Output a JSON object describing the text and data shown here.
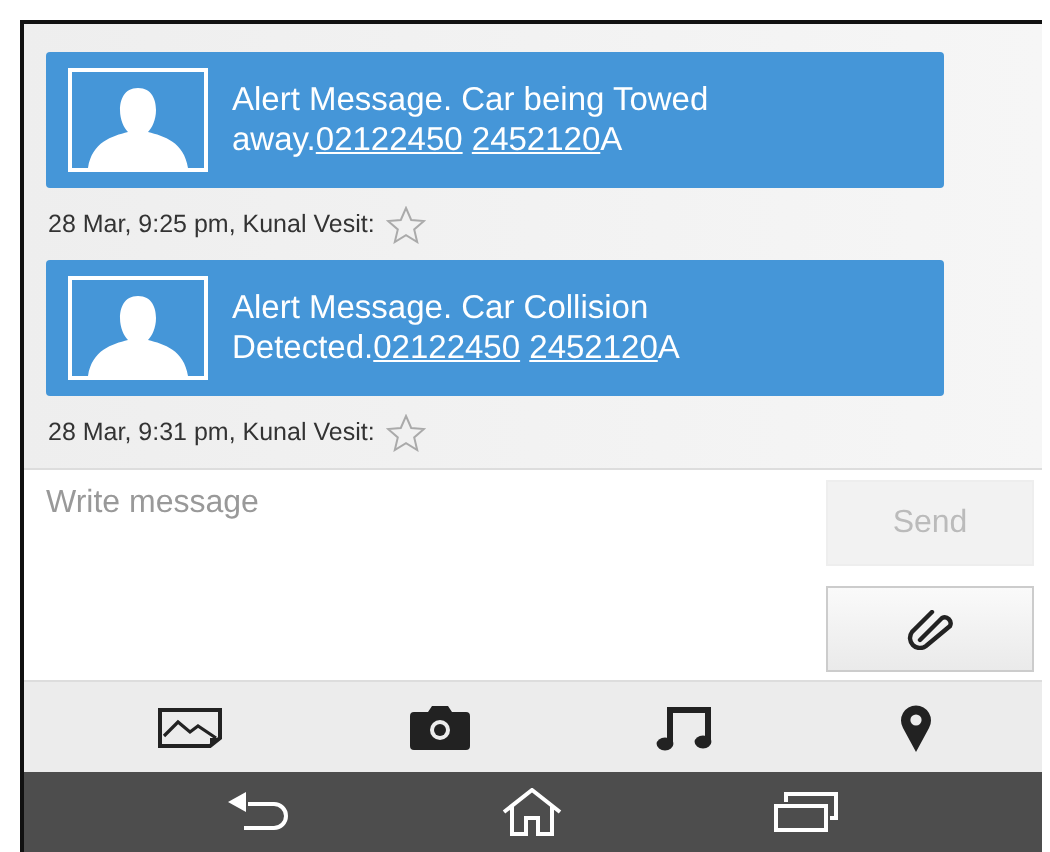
{
  "messages": [
    {
      "parts": [
        {
          "kind": "text",
          "text": "Alert Message. Car being Towed away."
        },
        {
          "kind": "link",
          "text": "02122450"
        },
        {
          "kind": "space"
        },
        {
          "kind": "link",
          "text": "2452120"
        },
        {
          "kind": "text",
          "text": "A"
        }
      ],
      "meta": "28 Mar, 9:25 pm, Kunal Vesit:",
      "starred": false
    },
    {
      "parts": [
        {
          "kind": "text",
          "text": "Alert Message. Car Collision Detected."
        },
        {
          "kind": "link",
          "text": "02122450"
        },
        {
          "kind": "space"
        },
        {
          "kind": "link",
          "text": "2452120"
        },
        {
          "kind": "text",
          "text": "A"
        }
      ],
      "meta": "28 Mar, 9:31 pm, Kunal Vesit:",
      "starred": false
    }
  ],
  "compose": {
    "placeholder": "Write message",
    "send_label": "Send",
    "send_disabled": true
  }
}
